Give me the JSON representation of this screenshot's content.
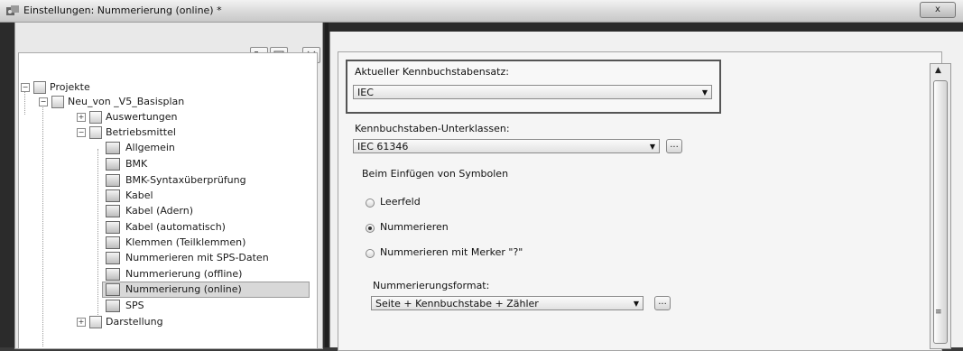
{
  "window": {
    "title": "Einstellungen: Nummerierung (online) *",
    "close_label": "x"
  },
  "tree_toolbar": {
    "buttons": [
      "expand-all-icon",
      "collapse-all-icon",
      "close-tree-icon"
    ]
  },
  "tree": {
    "root": "Projekte",
    "project": "Neu_von _V5_Basisplan",
    "auswertungen": "Auswertungen",
    "betriebsmittel": "Betriebsmittel",
    "children": [
      "Allgemein",
      "BMK",
      "BMK-Syntaxüberprüfung",
      "Kabel",
      "Kabel (Adern)",
      "Kabel (automatisch)",
      "Klemmen (Teilklemmen)",
      "Nummerieren mit SPS-Daten",
      "Nummerierung (offline)",
      "Nummerierung (online)",
      "SPS"
    ],
    "darstellung": "Darstellung",
    "selected": "Nummerierung (online)"
  },
  "settings": {
    "current_set_label": "Aktueller Kennbuchstabensatz:",
    "current_set_value": "IEC",
    "subclasses_label": "Kennbuchstaben-Unterklassen:",
    "subclasses_value": "IEC 61346",
    "insert_group_label": "Beim Einfügen von Symbolen",
    "radio_options": [
      "Leerfeld",
      "Nummerieren",
      "Nummerieren mit Merker \"?\""
    ],
    "radio_selected_index": 1,
    "format_label": "Nummerierungsformat:",
    "format_value": "Seite + Kennbuchstabe + Zähler",
    "browse_label": "..."
  }
}
